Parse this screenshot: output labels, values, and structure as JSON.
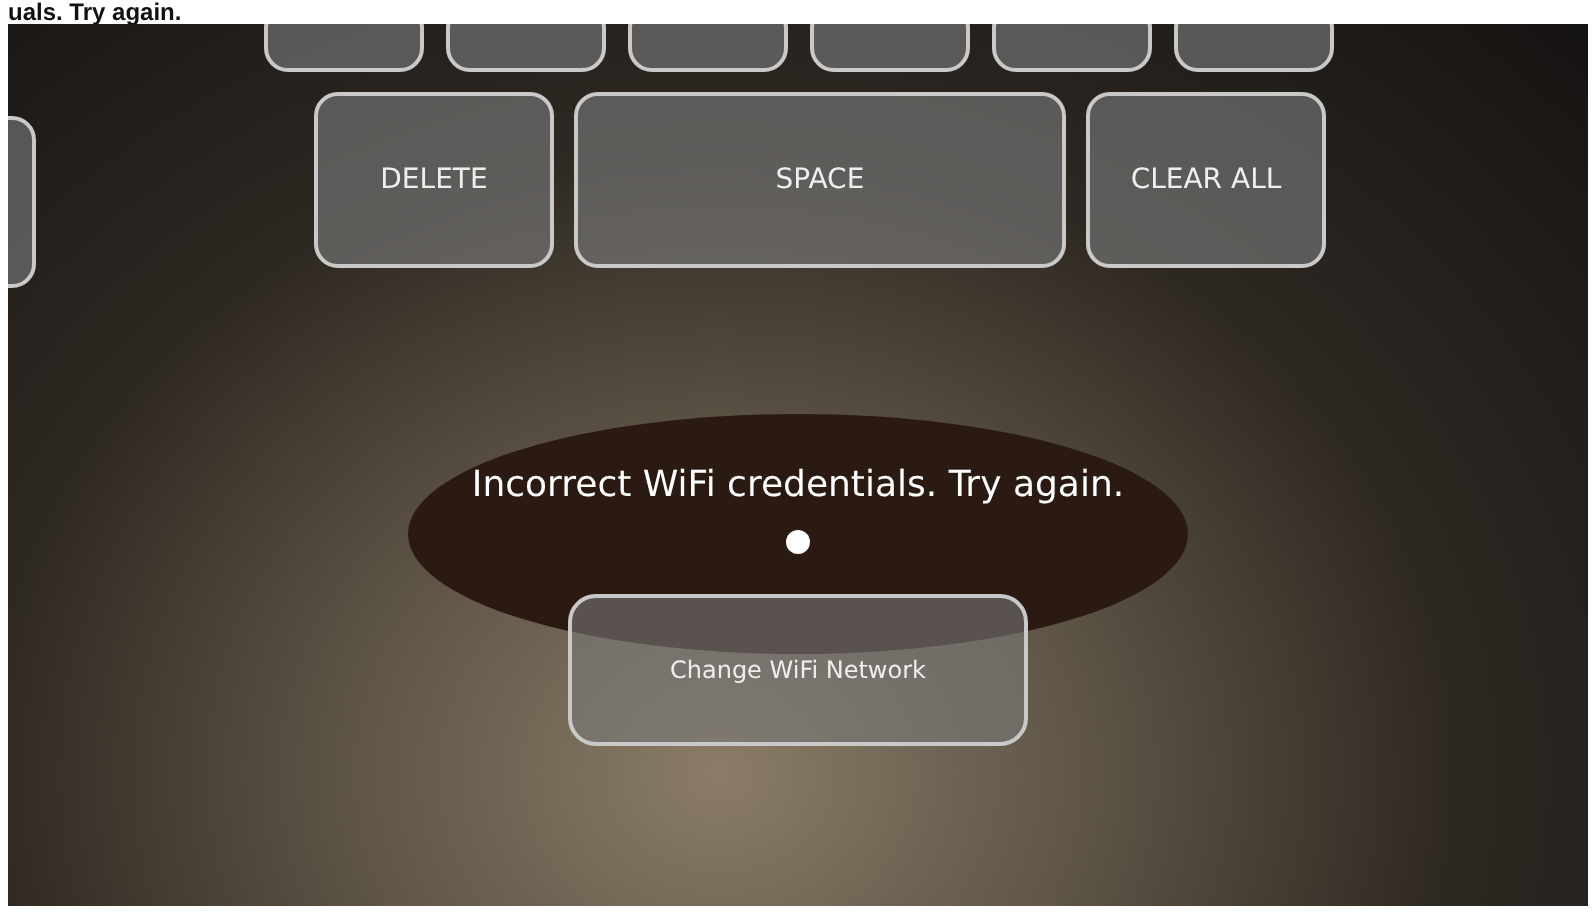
{
  "caption": "uals. Try again.",
  "keyboard": {
    "row_2": [
      {
        "label": "DELETE",
        "kind": "normal"
      },
      {
        "label": "SPACE",
        "kind": "wide"
      },
      {
        "label": "CLEAR ALL",
        "kind": "normal"
      }
    ]
  },
  "message": "Incorrect WiFi credentials. Try again.",
  "button": "Change WiFi Network"
}
